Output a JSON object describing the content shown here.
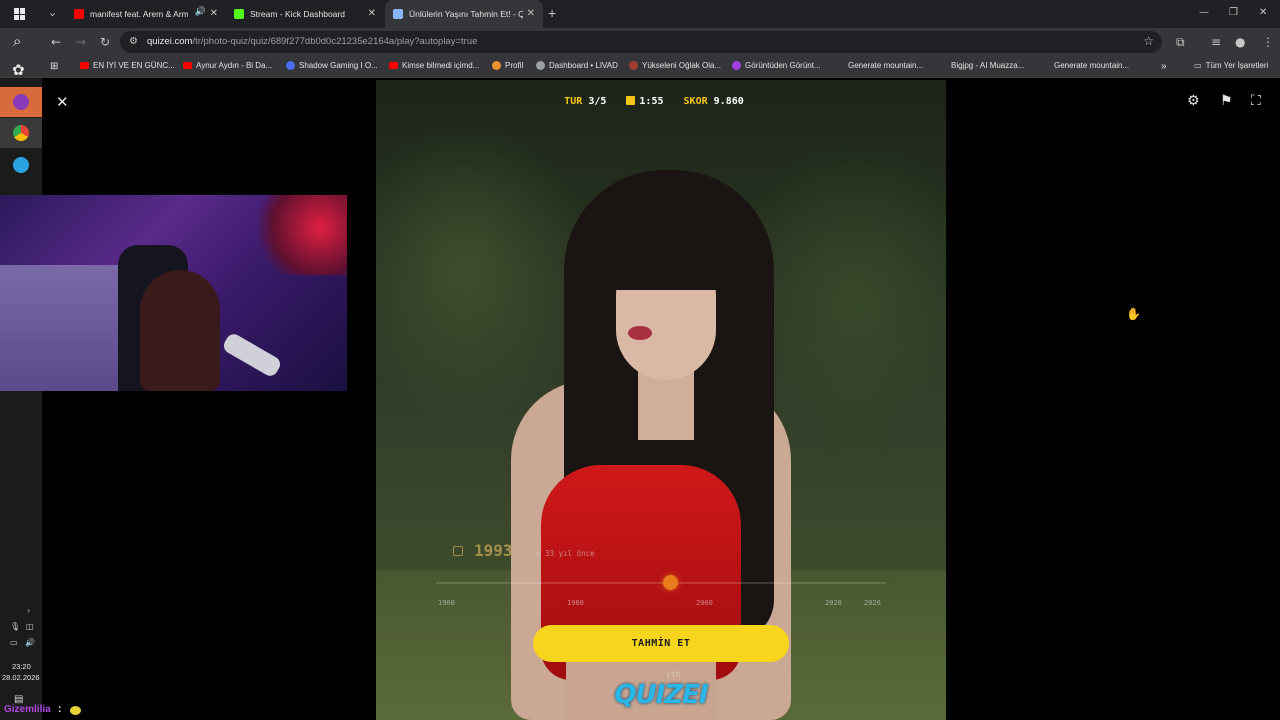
{
  "tabs": [
    {
      "title": "manifest feat. Arem & Arm",
      "favicon_color": "#ff0000",
      "audio": "🔊"
    },
    {
      "title": "Stream - Kick Dashboard",
      "favicon_color": "#53fc18"
    },
    {
      "title": "Ünlülerin Yaşını Tahmin Et! - Qu",
      "favicon_color": "#8ab4f8",
      "active": true
    }
  ],
  "toolbar": {
    "url_host": "quizei.com",
    "url_path": "/tr/photo-quiz/quiz/689f277db0d0c21235e2164a/play?autoplay=true"
  },
  "bookmarks": [
    {
      "label": "EN İYİ VE EN GÜNC...",
      "color": "#ff0000"
    },
    {
      "label": "Aynur Aydın - Bi Da...",
      "color": "#ff0000"
    },
    {
      "label": "Shadow Gaming I O...",
      "color": "#4a6cf7"
    },
    {
      "label": "Kimse bilmedi içimd...",
      "color": "#ff0000"
    },
    {
      "label": "Profil",
      "color": "#e8902a"
    },
    {
      "label": "Dashboard • LIVAD",
      "color": "#9aa0a6"
    },
    {
      "label": "Yükseleni Oğlak Ola...",
      "color": "#a04030"
    },
    {
      "label": "Görüntüden Görünt...",
      "color": "#a040e0"
    },
    {
      "label": "Generate mountain...",
      "color": ""
    },
    {
      "label": "Bigjpg - AI Muazza...",
      "color": ""
    },
    {
      "label": "Generate mountain...",
      "color": ""
    },
    {
      "label": "Tüm Yer İşaretleri",
      "color": ""
    }
  ],
  "game": {
    "round_label": "TUR",
    "round_value": "3/5",
    "time_value": "1:55",
    "score_label": "SKOR",
    "score_value": "9.860",
    "guess_year": "1993",
    "years_ago": "33 yıl önce",
    "guess_fraction": 0.52,
    "ticks": [
      "1960",
      "1980",
      "2000",
      "2020",
      "2026"
    ],
    "guess_button": "TAHMİN ET",
    "logo": "QUIZEI",
    "logo_sub": "ith"
  },
  "system": {
    "time": "23:20",
    "date": "28.02.2026"
  },
  "chat": {
    "username": "Gizemlilia",
    "colon": ":"
  },
  "icons": {
    "close": "close-icon",
    "settings": "gear-icon",
    "flag": "flag-icon",
    "fullscreen": "fullscreen-icon"
  }
}
